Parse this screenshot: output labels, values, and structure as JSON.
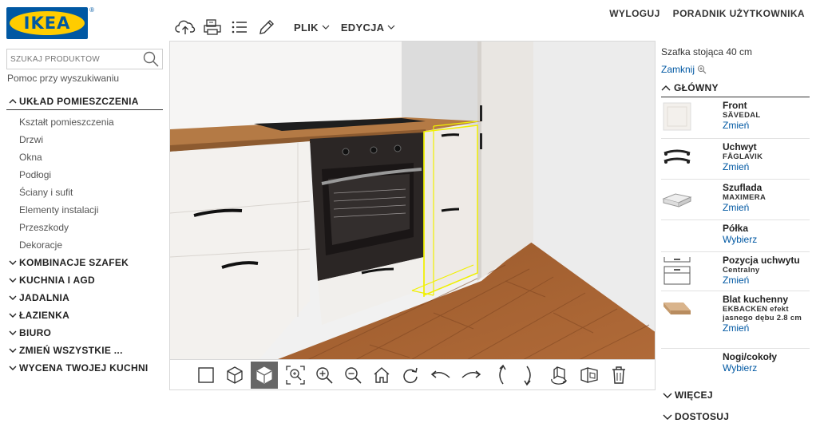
{
  "brand": {
    "logo_text": "IKEA",
    "reg_mark": "®"
  },
  "toolbar": {
    "menus": [
      {
        "label": "PLIK"
      },
      {
        "label": "EDYCJA"
      }
    ]
  },
  "top_links": {
    "logout": "WYLOGUJ",
    "guide": "PORADNIK UŻYTKOWNIKA"
  },
  "search": {
    "placeholder": "SZUKAJ PRODUKTÓW",
    "help": "Pomoc przy wyszukiwaniu"
  },
  "nav": {
    "room_layout": {
      "label": "UKŁAD POMIESZCZENIA",
      "items": [
        "Kształt pomieszczenia",
        "Drzwi",
        "Okna",
        "Podłogi",
        "Ściany i sufit",
        "Elementy instalacji",
        "Przeszkody",
        "Dekoracje"
      ]
    },
    "sections": [
      "KOMBINACJE SZAFEK",
      "KUCHNIA I AGD",
      "JADALNIA",
      "ŁAZIENKA",
      "BIURO",
      "ZMIEŃ WSZYSTKIE ...",
      "WYCENA TWOJEJ KUCHNI"
    ]
  },
  "panel": {
    "title": "Szafka stojąca 40 cm",
    "close": "Zamknij",
    "section_main": "GŁÓWNY",
    "items": [
      {
        "name": "Front",
        "sub": "SÄVEDAL",
        "action": "Zmień"
      },
      {
        "name": "Uchwyt",
        "sub": "FÅGLAVIK",
        "action": "Zmień"
      },
      {
        "name": "Szuflada",
        "sub": "MAXIMERA",
        "action": "Zmień"
      },
      {
        "name": "Półka",
        "sub": "",
        "action": "Wybierz"
      },
      {
        "name": "Pozycja uchwytu",
        "sub": "Centralny",
        "action": "Zmień"
      },
      {
        "name": "Blat kuchenny",
        "sub": "EKBACKEN efekt jasnego dębu 2.8 cm",
        "action": "Zmień"
      },
      {
        "name": "Nogi/cokoły",
        "sub": "",
        "action": "Wybierz"
      }
    ],
    "more": "WIĘCEJ",
    "customize": "DOSTOSUJ"
  },
  "colors": {
    "brand_blue": "#0058a3",
    "brand_yellow": "#ffcc00",
    "selection": "#f0f000"
  }
}
